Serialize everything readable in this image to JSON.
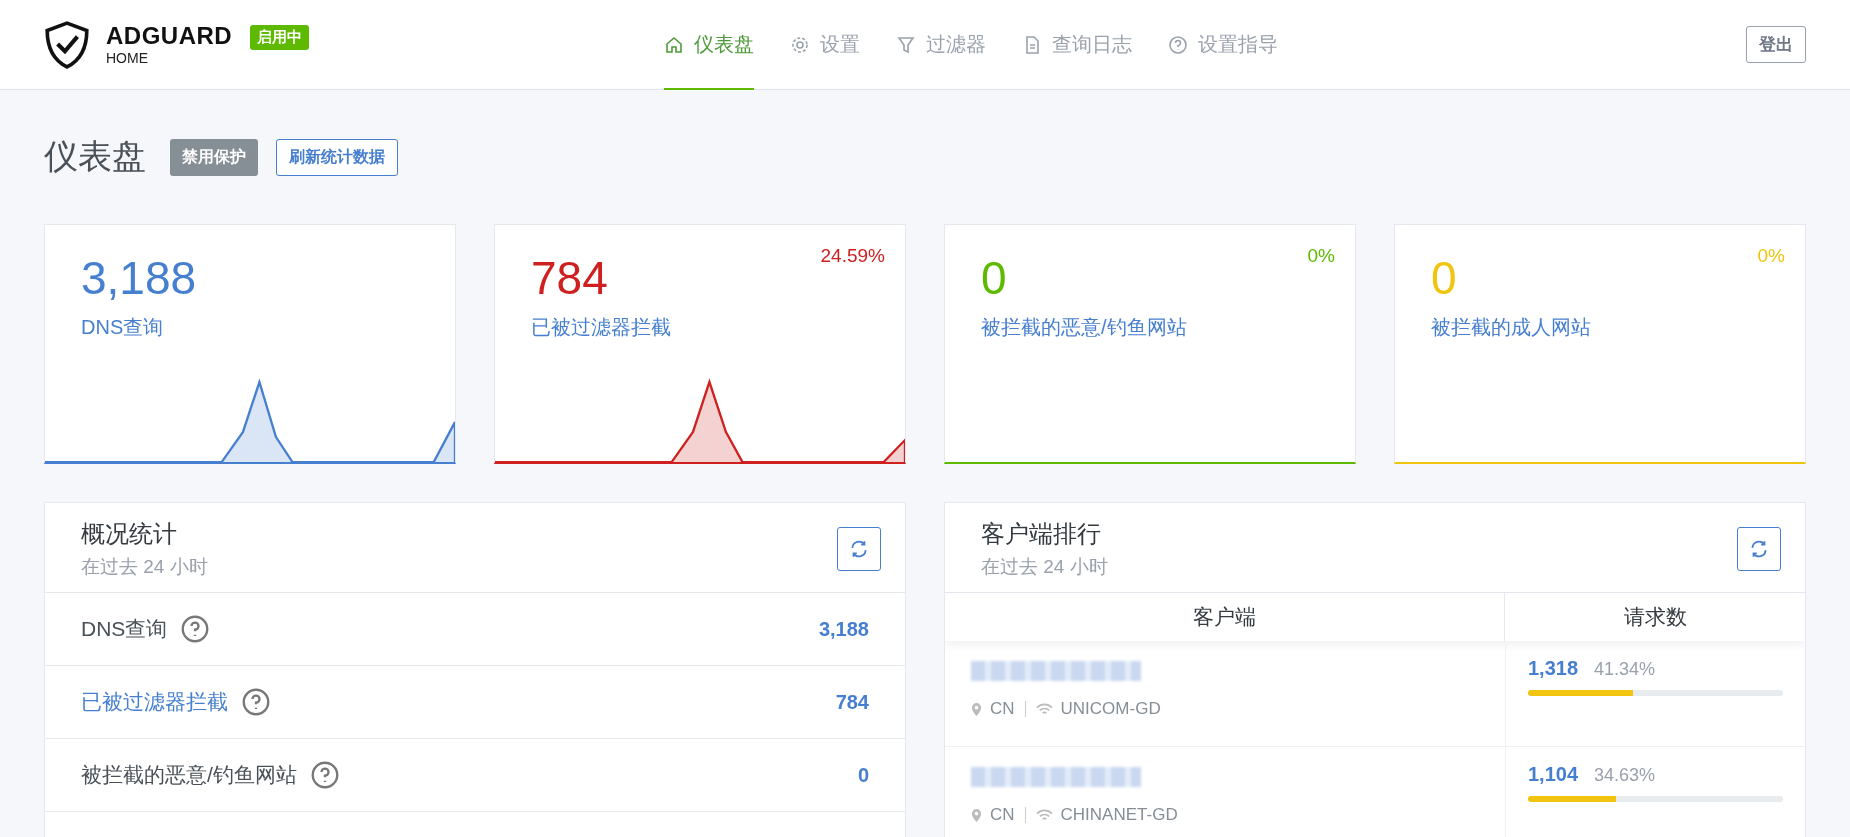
{
  "header": {
    "brand": "ADGUARD",
    "brand_sub": "HOME",
    "status_badge": "启用中",
    "nav": [
      {
        "label": "仪表盘",
        "selected": true
      },
      {
        "label": "设置",
        "selected": false
      },
      {
        "label": "过滤器",
        "selected": false
      },
      {
        "label": "查询日志",
        "selected": false
      },
      {
        "label": "设置指导",
        "selected": false
      }
    ],
    "logout": "登出"
  },
  "page": {
    "title": "仪表盘",
    "disable_button": "禁用保护",
    "refresh_button": "刷新统计数据"
  },
  "cards": [
    {
      "value": "3,188",
      "label": "DNS查询",
      "color": "#467fcf"
    },
    {
      "value": "784",
      "label": "已被过滤器拦截",
      "percent": "24.59%",
      "color": "#cd201f"
    },
    {
      "value": "0",
      "label": "被拦截的恶意/钓鱼网站",
      "percent": "0%",
      "color": "#5eba00"
    },
    {
      "value": "0",
      "label": "被拦截的成人网站",
      "percent": "0%",
      "color": "#f1c40f"
    }
  ],
  "overview": {
    "title": "概况统计",
    "subtitle": "在过去 24 小时",
    "rows": [
      {
        "label": "DNS查询",
        "value": "3,188",
        "kind": "plain"
      },
      {
        "label": "已被过滤器拦截",
        "value": "784",
        "kind": "link"
      },
      {
        "label": "被拦截的恶意/钓鱼网站",
        "value": "0",
        "kind": "plain"
      }
    ]
  },
  "clients": {
    "title": "客户端排行",
    "subtitle": "在过去 24 小时",
    "columns": [
      "客户端",
      "请求数"
    ],
    "rows": [
      {
        "country": "CN",
        "network": "UNICOM-GD",
        "count": "1,318",
        "percent": "41.34%",
        "level": 0.4134
      },
      {
        "country": "CN",
        "network": "CHINANET-GD",
        "count": "1,104",
        "percent": "34.63%",
        "level": 0.3463
      }
    ]
  }
}
